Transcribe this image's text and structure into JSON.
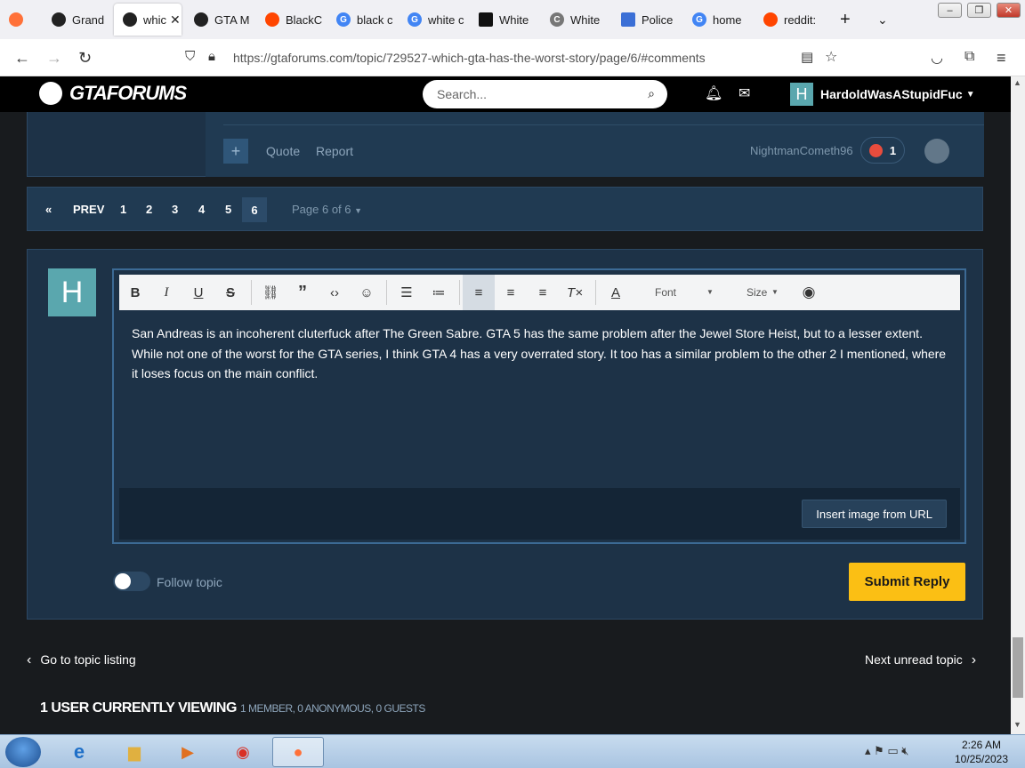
{
  "browser": {
    "tabs": [
      {
        "label": "Grand",
        "icon": "gtaforums-icon",
        "color": "#222222"
      },
      {
        "label": "which",
        "icon": "gtaforums-icon",
        "color": "#222222"
      },
      {
        "label": "GTA M",
        "icon": "gtaforums-icon",
        "color": "#222222"
      },
      {
        "label": "BlackC",
        "icon": "reddit-icon",
        "color": "#ff4500"
      },
      {
        "label": "black c",
        "icon": "google-icon",
        "color": "#4285f4"
      },
      {
        "label": "white c",
        "icon": "google-icon",
        "color": "#4285f4"
      },
      {
        "label": "White",
        "icon": "site-icon",
        "color": "#111111"
      },
      {
        "label": "White",
        "icon": "site-c-icon",
        "color": "#555555"
      },
      {
        "label": "Police",
        "icon": "calendar-icon",
        "color": "#3b6fd6"
      },
      {
        "label": "home",
        "icon": "google-icon",
        "color": "#4285f4"
      },
      {
        "label": "reddit:",
        "icon": "reddit-icon",
        "color": "#ff4500"
      }
    ],
    "url": "https://gtaforums.com/topic/729527-which-gta-has-the-worst-story/page/6/#comments"
  },
  "site": {
    "logo": "GTAFORUMS",
    "search_placeholder": "Search...",
    "username": "HardoldWasAStupidFuc",
    "avatar_letter": "H"
  },
  "post": {
    "quote_label": "Quote",
    "report_label": "Report",
    "author": "NightmanCometh96",
    "reaction_count": "1"
  },
  "pagination": {
    "first": "«",
    "prev": "PREV",
    "pages": [
      "1",
      "2",
      "3",
      "4",
      "5"
    ],
    "current": "6",
    "page_of": "Page 6 of 6"
  },
  "editor": {
    "font_label": "Font",
    "size_label": "Size",
    "text": "San Andreas is an incoherent cluterfuck after The Green Sabre. GTA 5 has the same problem after the Jewel Store Heist, but to a lesser extent. While not one of the worst for the GTA series, I think GTA 4 has a very overrated story. It too has a similar problem to the other 2 I mentioned, where it loses focus on the main conflict.",
    "insert_image_label": "Insert image from URL"
  },
  "reply": {
    "follow_label": "Follow topic",
    "submit_label": "Submit Reply"
  },
  "footer_nav": {
    "go_to_listing": "Go to topic listing",
    "next_unread": "Next unread topic"
  },
  "viewing": {
    "title": "1 USER CURRENTLY VIEWING",
    "detail": "1 MEMBER, 0 ANONYMOUS, 0 GUESTS"
  },
  "taskbar": {
    "time": "2:26 AM",
    "date": "10/25/2023"
  },
  "colors": {
    "accent": "#fbbf14",
    "panel": "#1d3247",
    "avatar": "#5aa7ae"
  }
}
